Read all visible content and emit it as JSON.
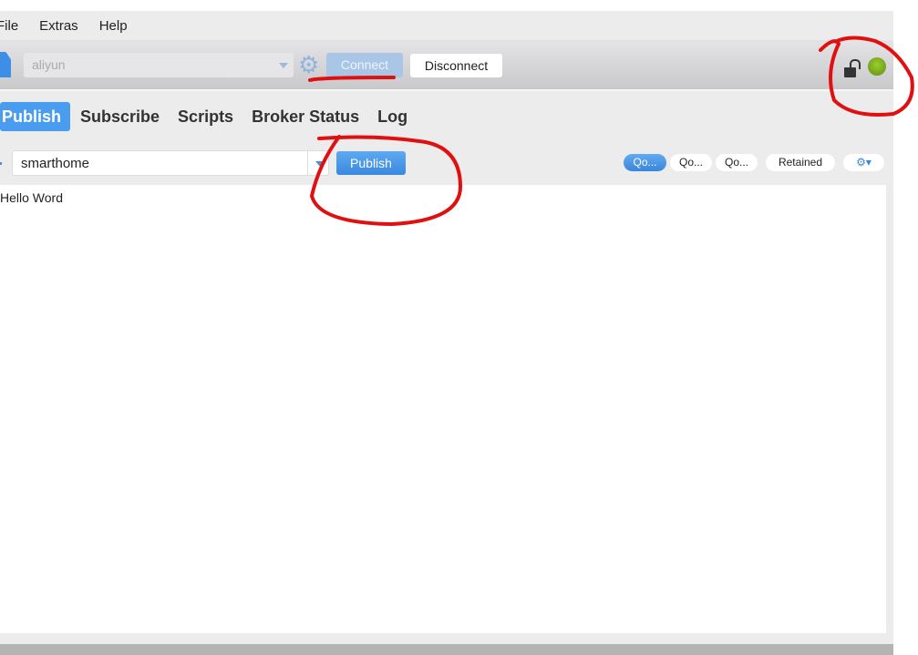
{
  "menu": [
    "File",
    "Extras",
    "Help"
  ],
  "toolbar": {
    "profile": "aliyun",
    "connect": "Connect",
    "disconnect": "Disconnect",
    "connection_status": "connected",
    "colors": {
      "status_led": "#7fb020",
      "accent": "#4a9cee"
    }
  },
  "tabs": [
    "Publish",
    "Subscribe",
    "Scripts",
    "Broker Status",
    "Log"
  ],
  "publish": {
    "topic": "smarthome",
    "publish_label": "Publish",
    "qos": [
      "Qo...",
      "Qo...",
      "Qo..."
    ],
    "qos_selected": 0,
    "retained": "Retained",
    "payload": "Hello Word"
  },
  "icons": [
    "file-icon",
    "gear-icon",
    "lock-open-icon",
    "status-led-icon",
    "settings-dropdown-icon"
  ]
}
